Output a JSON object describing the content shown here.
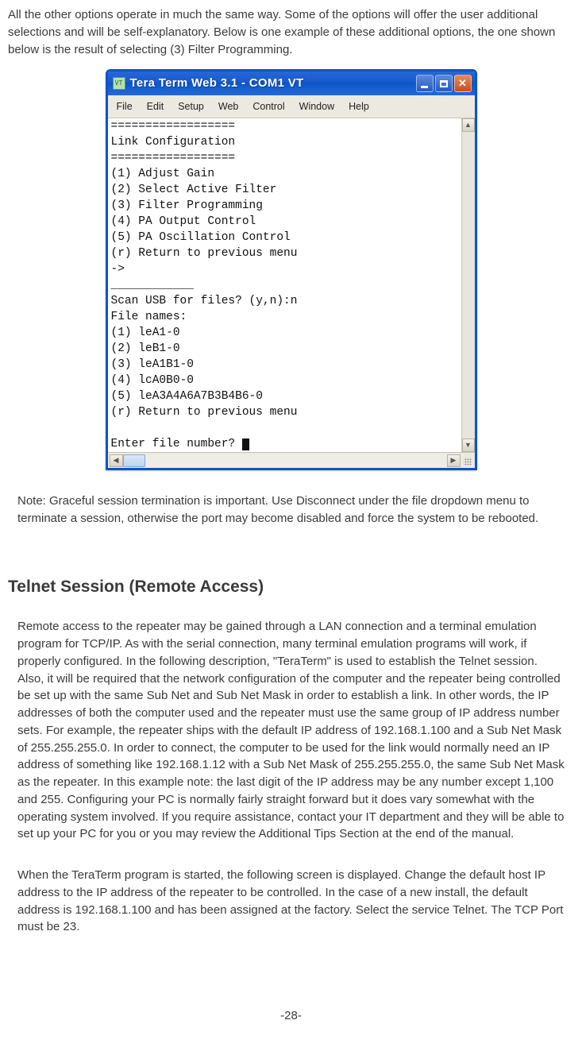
{
  "intro_paragraph": "All the other options operate in much the same way. Some of the options will offer the user additional selections and will be self-explanatory. Below is one example of these additional options, the one shown below is the result of selecting (3) Filter Programming.",
  "window": {
    "title": "Tera Term Web 3.1 - COM1 VT",
    "icon_label": "VT",
    "menu": [
      "File",
      "Edit",
      "Setup",
      "Web",
      "Control",
      "Window",
      "Help"
    ],
    "terminal_lines": [
      "==================",
      "Link Configuration",
      "==================",
      "(1) Adjust Gain",
      "(2) Select Active Filter",
      "(3) Filter Programming",
      "(4) PA Output Control",
      "(5) PA Oscillation Control",
      "(r) Return to previous menu",
      "->",
      "____________",
      "Scan USB for files? (y,n):n",
      "File names:",
      "(1) leA1-0",
      "(2) leB1-0",
      "(3) leA1B1-0",
      "(4) lcA0B0-0",
      "(5) leA3A4A6A7B3B4B6-0",
      "(r) Return to previous menu",
      "",
      "Enter file number? "
    ]
  },
  "note_paragraph": "Note: Graceful session termination is important. Use Disconnect under the file dropdown menu to terminate a session, otherwise the port may become disabled and force the system to be rebooted.",
  "section_heading": "Telnet Session (Remote Access)",
  "telnet_paragraph": "Remote access to the repeater may be gained through a LAN connection and a terminal emulation program for TCP/IP. As with the serial connection, many terminal emulation programs will work, if properly configured.  In the following description, \"TeraTerm\" is used to establish the Telnet session. Also, it will be required that the network configuration of the computer and the repeater being controlled be set up with the same Sub Net and Sub Net Mask in order to establish a link. In other words, the IP addresses of both the computer used and the repeater must use the same group of IP address number sets. For example, the repeater ships with the default IP address of 192.168.1.100 and a Sub Net Mask of 255.255.255.0. In order to connect, the computer to be used for the link would normally need an IP address of something like 192.168.1.12 with a Sub Net Mask of 255.255.255.0, the same Sub Net Mask as the repeater. In this example note: the last digit of the IP address may be any number except 1,100 and 255.  Configuring your PC is normally fairly straight forward but it does vary somewhat with the operating system involved.  If you require assistance, contact your IT department and they will be able to set up your PC for you or you may review the Additional Tips Section at the end of the manual.",
  "telnet_paragraph2": "When the TeraTerm program is started, the following screen is displayed. Change the default host IP address to the IP address of the repeater to be controlled. In the case of a new install, the default address is 192.168.1.100 and has been assigned at the factory. Select the service Telnet. The TCP Port must be 23.",
  "page_number": "-28-"
}
